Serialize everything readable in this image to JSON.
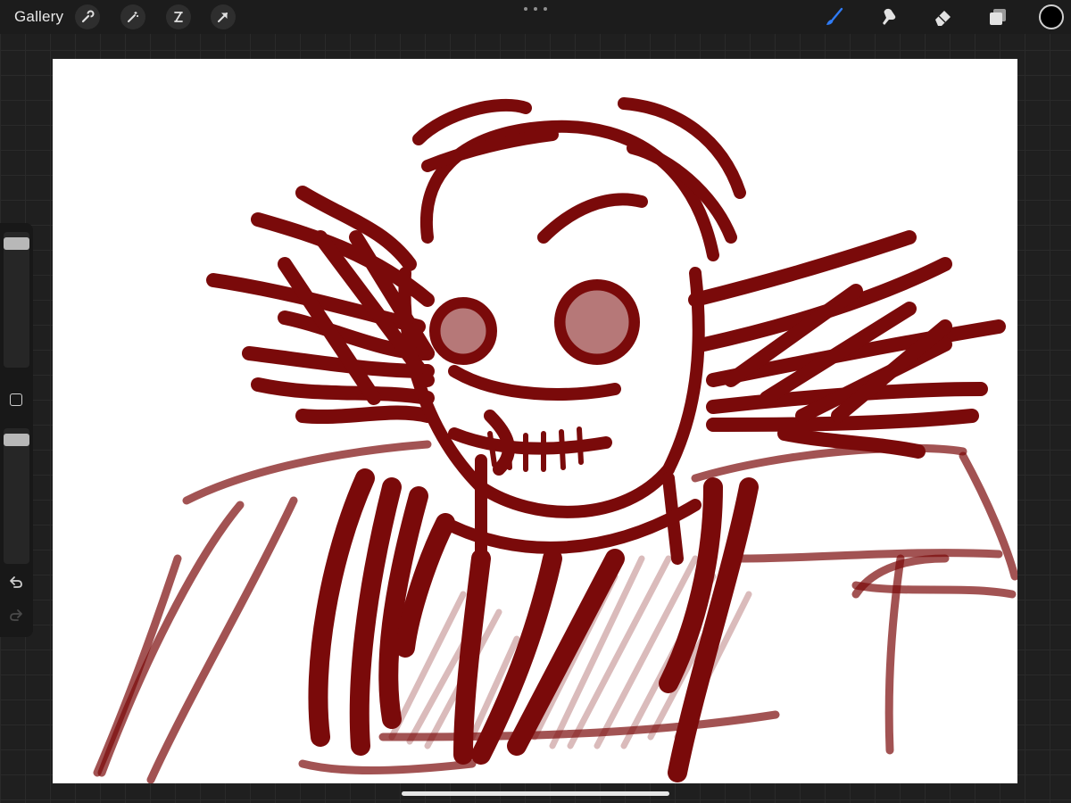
{
  "topbar": {
    "gallery_label": "Gallery",
    "left_tools": [
      "wrench-icon",
      "magic-wand-icon",
      "selection-icon",
      "transform-arrow-icon"
    ],
    "right_tools": [
      "brush-icon",
      "smudge-icon",
      "eraser-icon",
      "layers-icon"
    ],
    "active_tool": "brush-icon",
    "active_color": "#000000",
    "accent_color": "#2f7bf5"
  },
  "sidebar": {
    "size_slider_level": 0.96,
    "opacity_slider_level": 0.96,
    "buttons": [
      "modify-button",
      "undo-icon",
      "redo-icon"
    ]
  },
  "canvas": {
    "background": "#ffffff",
    "stroke_color": "#7a0a0a"
  }
}
